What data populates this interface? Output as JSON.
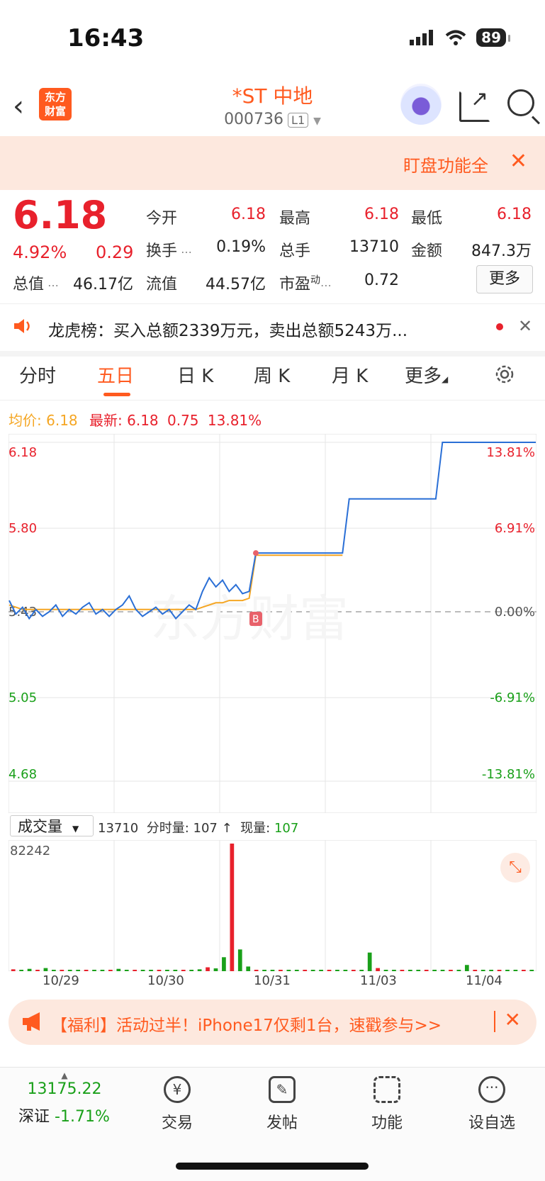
{
  "status": {
    "time": "16:43",
    "battery": "89"
  },
  "nav": {
    "logo_line1": "东方",
    "logo_line2": "财富",
    "title": "*ST 中地",
    "code": "000736",
    "level": "L1"
  },
  "banner": {
    "text": "盯盘功能全",
    "close": "✕"
  },
  "quote": {
    "price": "6.18",
    "change_pct": "4.92%",
    "change": "0.29",
    "open_label": "今开",
    "open": "6.18",
    "high_label": "最高",
    "high": "6.18",
    "low_label": "最低",
    "low": "6.18",
    "turnover_label": "换手",
    "turnover": "0.19%",
    "volume_label": "总手",
    "volume": "13710",
    "amount_label": "金额",
    "amount": "847.3万",
    "mktcap_label": "总值",
    "mktcap": "46.17亿",
    "float_label": "流值",
    "float": "44.57亿",
    "pe_label": "市盈",
    "pe_sup": "动",
    "pe": "0.72",
    "more": "更多"
  },
  "notice": {
    "text": "龙虎榜：买入总额2339万元，卖出总额5243万..."
  },
  "tabs": [
    "分时",
    "五日",
    "日 K",
    "周 K",
    "月 K",
    "更多"
  ],
  "info": {
    "avg_label": "均价:",
    "avg": "6.18",
    "last_label": "最新:",
    "last": "6.18",
    "chg": "0.75",
    "chg_pct": "13.81%"
  },
  "chart_data": {
    "type": "line",
    "y_labels_left": [
      "6.18",
      "5.80",
      "5.43",
      "5.05",
      "4.68"
    ],
    "y_labels_right": [
      "13.81%",
      "6.91%",
      "0.00%",
      "-6.91%",
      "-13.81%"
    ],
    "ylim": [
      4.68,
      6.18
    ],
    "prev_close": 5.43,
    "x_labels": [
      "10/29",
      "10/30",
      "10/31",
      "11/03",
      "11/04"
    ],
    "series": [
      {
        "values": [
          5.48,
          5.42,
          5.45,
          5.4,
          5.44,
          5.41,
          5.43,
          5.46,
          5.41,
          5.44,
          5.42,
          5.45,
          5.47,
          5.42,
          5.44,
          5.41,
          5.44,
          5.46,
          5.5,
          5.44,
          5.41,
          5.43,
          5.45,
          5.42,
          5.44,
          5.4,
          5.43,
          5.46,
          5.44,
          5.52,
          5.58,
          5.54,
          5.57,
          5.52,
          5.55,
          5.51,
          5.52,
          5.69,
          5.69,
          5.69,
          5.69,
          5.69,
          5.69,
          5.69,
          5.69,
          5.69,
          5.69,
          5.69,
          5.69,
          5.69,
          5.69,
          5.93,
          5.93,
          5.93,
          5.93,
          5.93,
          5.93,
          5.93,
          5.93,
          5.93,
          5.93,
          5.93,
          5.93,
          5.93,
          5.93,
          6.18,
          6.18,
          6.18,
          6.18,
          6.18,
          6.18,
          6.18,
          6.18,
          6.18,
          6.18,
          6.18,
          6.18,
          6.18,
          6.18,
          6.18
        ]
      },
      {
        "values": [
          5.46,
          5.45,
          5.44,
          5.44,
          5.44,
          5.44,
          5.44,
          5.44,
          5.44,
          5.44,
          5.44,
          5.44,
          5.44,
          5.44,
          5.44,
          5.44,
          5.44,
          5.44,
          5.44,
          5.44,
          5.44,
          5.44,
          5.44,
          5.44,
          5.44,
          5.44,
          5.44,
          5.44,
          5.44,
          5.45,
          5.46,
          5.47,
          5.47,
          5.48,
          5.48,
          5.48,
          5.49,
          5.68,
          5.68,
          5.68,
          5.68,
          5.68,
          5.68,
          5.68,
          5.68,
          5.68,
          5.68,
          5.68,
          5.68,
          5.68,
          5.68
        ]
      }
    ]
  },
  "volume": {
    "selector": "成交量",
    "total": "13710",
    "label": "分时量:",
    "value": "107",
    "arrow": "↑",
    "now_label": "现量:",
    "now": "107",
    "max": "82242",
    "values": [
      1200,
      800,
      1500,
      600,
      2000,
      700,
      400,
      900,
      300,
      500,
      600,
      400,
      800,
      1500,
      900,
      700,
      600,
      500,
      800,
      600,
      900,
      400,
      500,
      1200,
      2500,
      1800,
      9000,
      82242,
      14000,
      3000,
      800,
      700,
      600,
      500,
      400,
      300,
      500,
      400,
      300,
      200,
      300,
      400,
      300,
      200,
      12000,
      2000,
      500,
      300,
      200,
      300,
      200,
      300,
      200,
      300,
      200,
      300,
      4000,
      800,
      300,
      200,
      300,
      200,
      300,
      200,
      300
    ]
  },
  "ad": {
    "text": "【福利】活动过半！iPhone17仅剩1台，速戳参与>>"
  },
  "bottom": {
    "index_value": "13175.22",
    "index_name": "深证",
    "index_chg": "-1.71%",
    "trade": "交易",
    "post": "发帖",
    "features": "功能",
    "watch": "设自选"
  }
}
